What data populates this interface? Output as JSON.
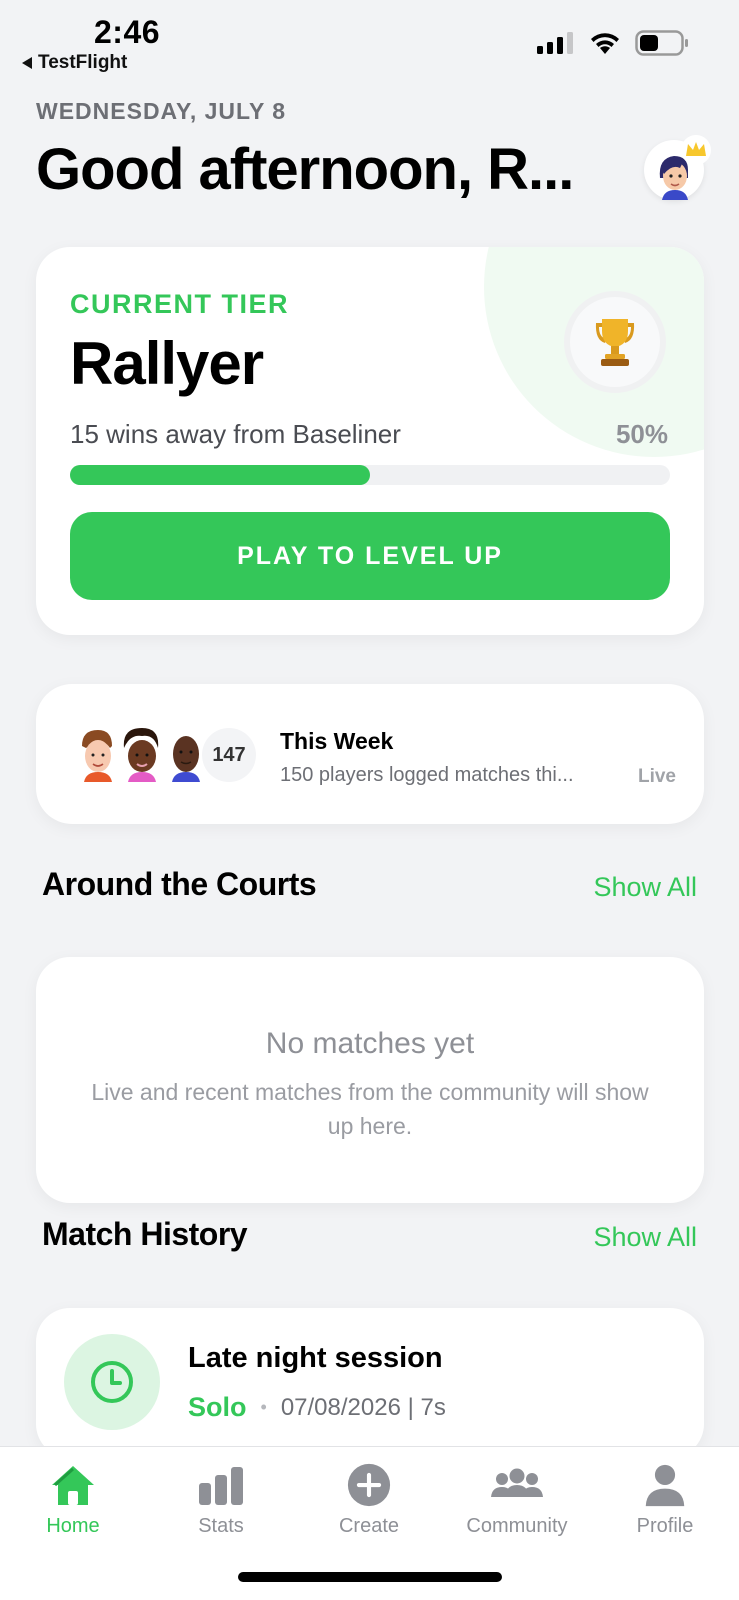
{
  "status_bar": {
    "time": "2:46",
    "back_app": "TestFlight",
    "battery_level": 0.45
  },
  "header": {
    "date": "WEDNESDAY, JULY 8",
    "greeting": "Good afternoon, R..."
  },
  "tier_card": {
    "label": "CURRENT TIER",
    "name": "Rallyer",
    "subtitle": "15 wins away from Baseliner",
    "percent_label": "50%",
    "progress": 0.5,
    "button_label": "PLAY TO LEVEL UP",
    "icon": "trophy-icon"
  },
  "week_card": {
    "count": "147",
    "title": "This Week",
    "subtitle": "150 players logged matches thi...",
    "badge": "Live"
  },
  "around_courts": {
    "title": "Around the Courts",
    "show_all": "Show All",
    "empty_title": "No matches yet",
    "empty_subtitle": "Live and recent matches from the community will show up here."
  },
  "match_history": {
    "title": "Match History",
    "show_all": "Show All",
    "items": [
      {
        "title": "Late night session",
        "mode": "Solo",
        "meta": "07/08/2026 | 7s",
        "icon": "clock-icon"
      }
    ]
  },
  "tab_bar": {
    "tabs": [
      {
        "label": "Home",
        "icon": "home-icon",
        "active": true
      },
      {
        "label": "Stats",
        "icon": "bar-chart-icon",
        "active": false
      },
      {
        "label": "Create",
        "icon": "plus-circle-icon",
        "active": false
      },
      {
        "label": "Community",
        "icon": "people-icon",
        "active": false
      },
      {
        "label": "Profile",
        "icon": "person-icon",
        "active": false
      }
    ]
  },
  "colors": {
    "accent": "#34c759",
    "background": "#f2f3f5",
    "card": "#ffffff",
    "muted": "#8e9096"
  }
}
